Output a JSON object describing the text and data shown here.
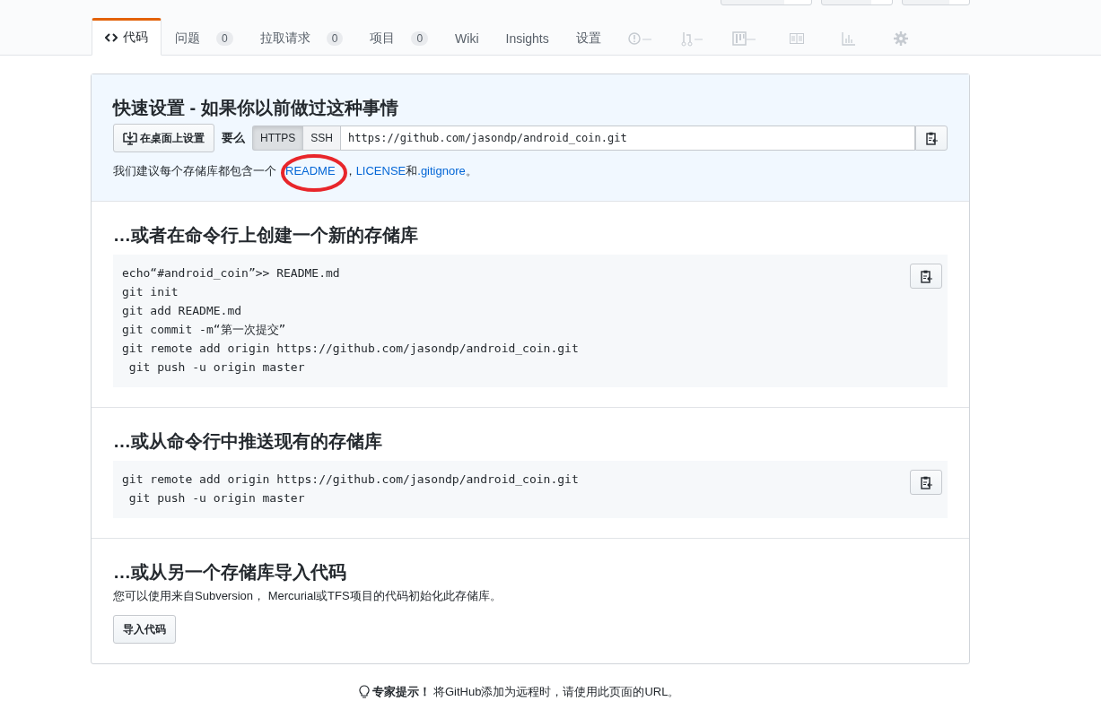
{
  "header_buttons": [
    {
      "kind": "split"
    },
    {
      "kind": "split"
    },
    {
      "kind": "split"
    }
  ],
  "tabs": [
    {
      "label": "代码",
      "kind": "code",
      "selected": true
    },
    {
      "label": "问题",
      "kind": "text",
      "count": "0",
      "selected": false
    },
    {
      "label": "拉取请求",
      "kind": "text",
      "count": "0",
      "selected": false
    },
    {
      "label": "项目",
      "kind": "text",
      "count": "0",
      "selected": false
    },
    {
      "label": "Wiki",
      "kind": "text",
      "selected": false
    },
    {
      "label": "Insights",
      "kind": "text",
      "selected": false
    },
    {
      "label": "设置",
      "kind": "text",
      "selected": false
    }
  ],
  "icon_tabs": [
    {
      "kind": "issue"
    },
    {
      "kind": "pull"
    },
    {
      "kind": "project"
    },
    {
      "kind": "wiki"
    },
    {
      "kind": "graph"
    },
    {
      "kind": "gear"
    }
  ],
  "quick_setup": {
    "title": "快速设置 - 如果你以前做过这种事情",
    "desktop_button": "在桌面上设置",
    "or_label": "要么",
    "protocols": [
      {
        "label": "HTTPS",
        "selected": true
      },
      {
        "label": "SSH",
        "selected": false
      }
    ],
    "url": "https://github.com/jasondp/android_coin.git",
    "hint": [
      {
        "kind": "text",
        "text": "我们建议每个存储库都包含一个"
      },
      {
        "kind": "link",
        "text": "README",
        "circled": true
      },
      {
        "kind": "text",
        "text": "，"
      },
      {
        "kind": "link",
        "text": "LICENSE"
      },
      {
        "kind": "text",
        "text": "和"
      },
      {
        "kind": "link",
        "text": ".gitignore"
      },
      {
        "kind": "text",
        "text": "。"
      }
    ]
  },
  "sections": [
    {
      "kind": "code",
      "title": "…或者在命令行上创建一个新的存储库",
      "lines": [
        "echo“#android_coin”>> README.md",
        "git init",
        "git add README.md",
        "git commit -m“第一次提交”",
        "git remote add origin https://github.com/jasondp/android_coin.git",
        " git push -u origin master"
      ]
    },
    {
      "kind": "code",
      "title": "…或从命令行中推送现有的存储库",
      "lines": [
        "git remote add origin https://github.com/jasondp/android_coin.git",
        " git push -u origin master"
      ]
    },
    {
      "kind": "import",
      "title": "…或从另一个存储库导入代码",
      "text": "您可以使用来自Subversion， Mercurial或TFS项目的代码初始化此存储库。",
      "button": "导入代码"
    }
  ],
  "protip": {
    "label": "专家提示！",
    "text": "将GitHub添加为远程时，请使用此页面的URL。"
  }
}
